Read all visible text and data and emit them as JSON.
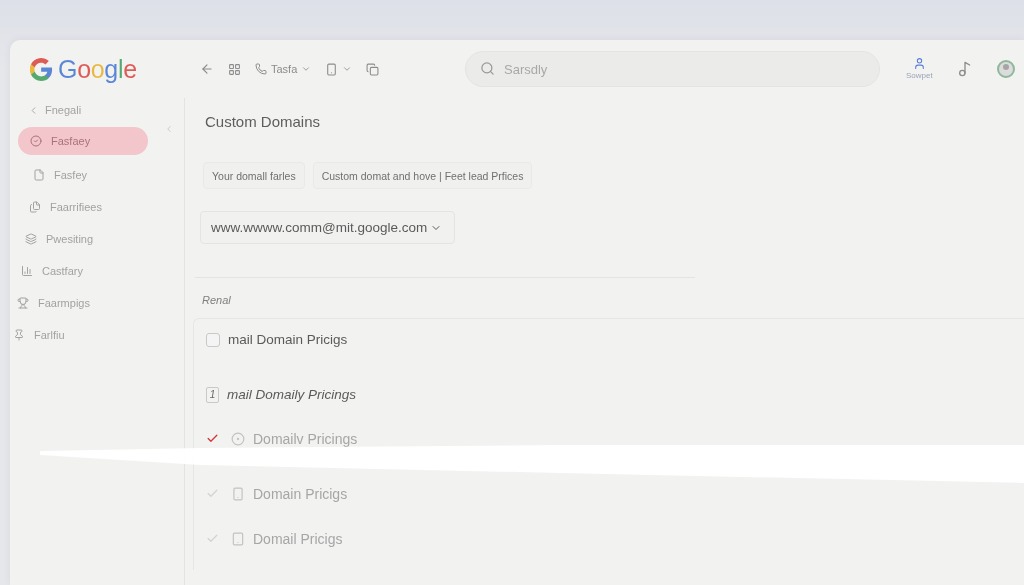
{
  "header": {
    "logo": "Google",
    "toolbar": {
      "phone_label": "Tasfa"
    },
    "search": {
      "placeholder": "Sarsdly"
    },
    "account": {
      "label": "Sowpet"
    }
  },
  "sidebar": {
    "back": "Fnegali",
    "items": [
      {
        "label": "Fasfaey",
        "selected": true
      },
      {
        "label": "Fasfey",
        "selected": false
      },
      {
        "label": "Faarrifiees",
        "selected": false
      },
      {
        "label": "Pwesiting",
        "selected": false
      },
      {
        "label": "Castfary",
        "selected": false
      },
      {
        "label": "Faarmpigs",
        "selected": false
      },
      {
        "label": "Farlfiu",
        "selected": false
      }
    ]
  },
  "main": {
    "title": "Custom Domains",
    "chips": [
      "Your domall farles",
      "Custom domat and hove | Feet lead Prfices"
    ],
    "domain_select": {
      "value": "www.wwww.comm@mit.google.com"
    },
    "section_label": "Renal",
    "rows": [
      {
        "kind": "checkbox",
        "checked": false,
        "label": "mail Domain Pricigs"
      },
      {
        "kind": "badge",
        "badge": "1",
        "label": "mail Domaily Pricings"
      },
      {
        "kind": "tick",
        "checked": true,
        "label": "Domailv Pricings"
      },
      {
        "kind": "tick",
        "checked": false,
        "label": "Domain Pricigs"
      },
      {
        "kind": "tick",
        "checked": false,
        "label": "Domail Pricigs"
      }
    ]
  }
}
